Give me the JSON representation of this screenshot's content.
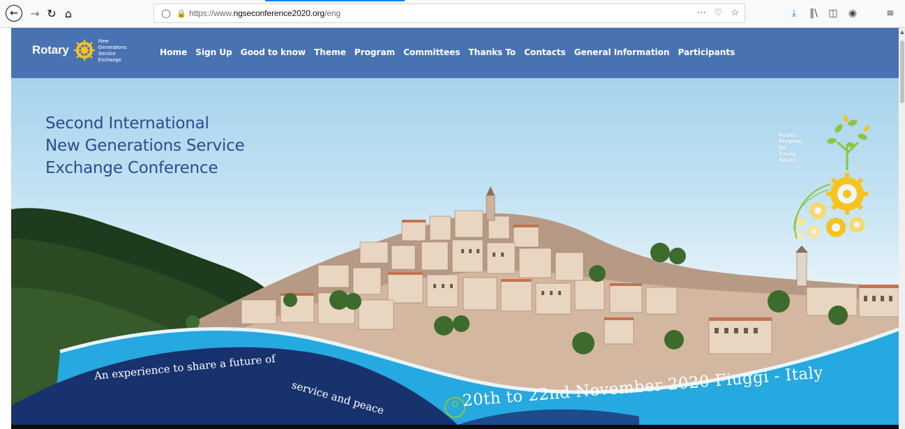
{
  "browser": {
    "url_prefix": "https://www.",
    "url_domain": "ngseconference2020.org",
    "url_path": "/eng",
    "icons": [
      "back-icon",
      "forward-icon",
      "reload-icon",
      "home-icon",
      "tracking-shield-icon",
      "lock-icon",
      "page-actions-icon",
      "pocket-icon",
      "bookmark-star-icon",
      "download-icon",
      "library-icon",
      "sidebar-icon",
      "account-icon",
      "menu-icon"
    ]
  },
  "header": {
    "brand_word": "Rotary",
    "brand_sub": [
      "New",
      "Generations",
      "Service",
      "Exchange"
    ],
    "nav": [
      "Home",
      "Sign Up",
      "Good to know",
      "Theme",
      "Program",
      "Committees",
      "Thanks To",
      "Contacts",
      "General Information",
      "Participants"
    ],
    "color": "#4872b1"
  },
  "hero": {
    "title_lines": [
      "Second International",
      "New Generations Service",
      "Exchange Conference"
    ],
    "badge_lines": [
      "Rotary",
      "Program",
      "for",
      "Young",
      "Adults"
    ],
    "tagline_left_a": "An experience to share a future of ",
    "tagline_left_b": "service and peace",
    "tagline_right": "20th to 22nd November 2020 Fiuggi - Italy"
  },
  "colors": {
    "title": "#2c4b91",
    "wave_dark": "#17326d",
    "wave_light": "#26a8e0",
    "rotary_gold": "#f7c31e",
    "badge_green": "#8cc63f"
  }
}
